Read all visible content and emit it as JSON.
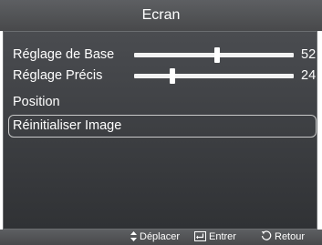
{
  "title": "Ecran",
  "menu": {
    "items": [
      {
        "label": "Réglage de Base",
        "type": "slider",
        "value": 52,
        "max": 100
      },
      {
        "label": "Réglage Précis",
        "type": "slider",
        "value": 24,
        "max": 100
      },
      {
        "label": "Position",
        "type": "item"
      },
      {
        "label": "Réinitialiser Image",
        "type": "item",
        "selected": true
      }
    ]
  },
  "footer": {
    "move": {
      "icon": "up-down-arrows-icon",
      "label": "Déplacer"
    },
    "enter": {
      "icon": "enter-icon",
      "label": "Entrer"
    },
    "return": {
      "icon": "return-icon",
      "label": "Retour"
    }
  },
  "colors": {
    "panel_background": "#3a3c40",
    "bar_background": "#525457",
    "text": "#ffffff",
    "selection_outline": "#c9c9c9"
  }
}
